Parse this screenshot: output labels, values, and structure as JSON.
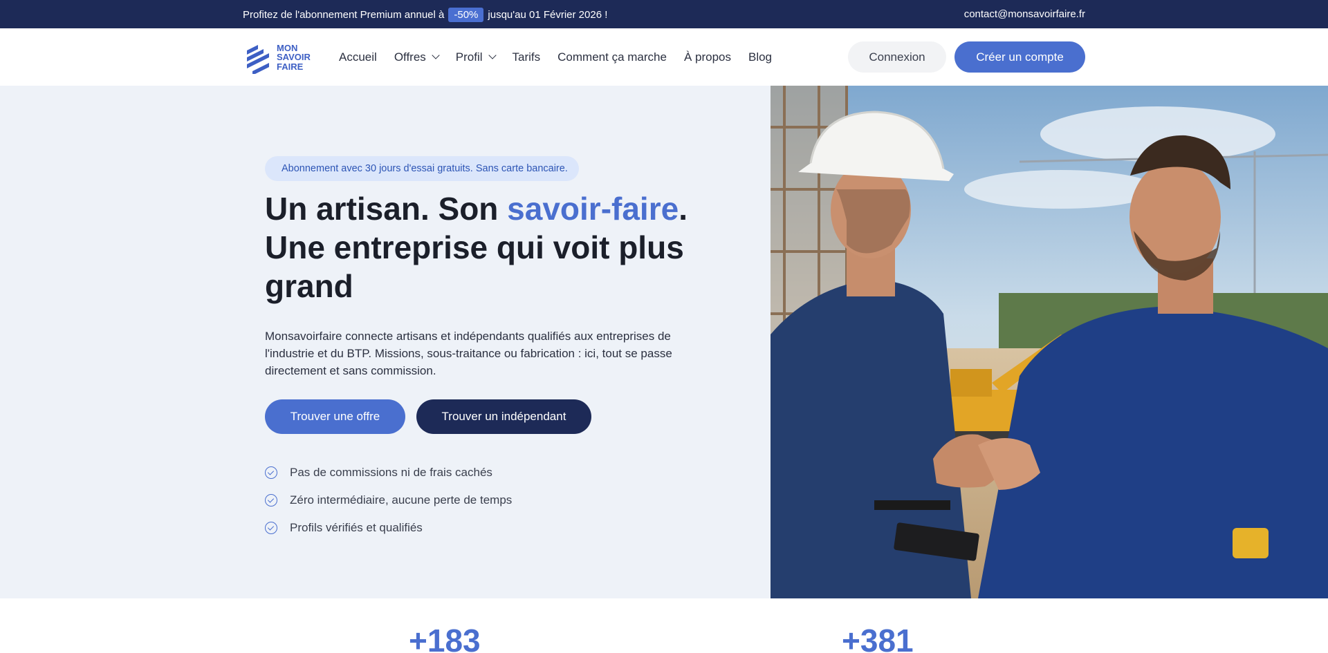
{
  "promo": {
    "prefix": "Profitez de l'abonnement Premium annuel à",
    "badge": "-50%",
    "suffix": "jusqu'au 01 Février 2026 !",
    "email": "contact@monsavoirfaire.fr"
  },
  "brand": {
    "line1": "MON",
    "line2": "SAVOIR",
    "line3": "FAIRE"
  },
  "nav": {
    "items": [
      {
        "label": "Accueil"
      },
      {
        "label": "Offres"
      },
      {
        "label": "Profil"
      },
      {
        "label": "Tarifs"
      },
      {
        "label": "Comment ça marche"
      },
      {
        "label": "À propos"
      },
      {
        "label": "Blog"
      }
    ],
    "login": "Connexion",
    "signup": "Créer un compte"
  },
  "hero": {
    "pill": "Abonnement avec 30 jours d'essai gratuits. Sans carte bancaire.",
    "title_part1": "Un artisan. Son ",
    "title_accent": "savoir-faire",
    "title_part2": ".",
    "title_line2": "Une entreprise qui voit plus grand",
    "description": "Monsavoirfaire connecte artisans et indépendants qualifiés aux entreprises de l'industrie et du BTP. Missions, sous-traitance ou fabrication : ici, tout se passe directement et sans commission.",
    "cta_primary": "Trouver une offre",
    "cta_secondary": "Trouver un indépendant",
    "checks": [
      "Pas de commissions ni de frais cachés",
      "Zéro intermédiaire, aucune perte de temps",
      "Profils vérifiés et qualifiés"
    ]
  },
  "stats": {
    "first": "+183",
    "second": "+381"
  },
  "colors": {
    "navy": "#1d2a57",
    "accent": "#4a6fcf",
    "hero_bg": "#eef2f8"
  },
  "icons": [
    "logo-icon",
    "chevron-down-icon",
    "check-circle-icon"
  ]
}
